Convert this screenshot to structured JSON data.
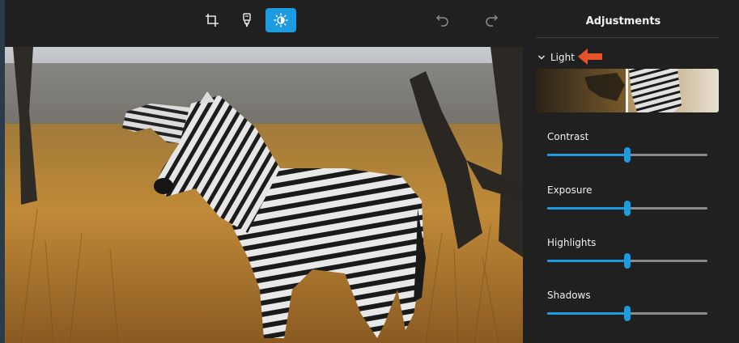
{
  "toolbar": {
    "tools": [
      {
        "name": "crop-tool",
        "icon": "crop-icon",
        "active": false
      },
      {
        "name": "markup-tool",
        "icon": "marker-icon",
        "active": false
      },
      {
        "name": "adjust-tool",
        "icon": "brightness-icon",
        "active": true
      }
    ],
    "undo_icon": "undo-icon",
    "redo_icon": "redo-icon"
  },
  "panel": {
    "title": "Adjustments",
    "section": {
      "label": "Light",
      "expanded": true
    },
    "sliders": [
      {
        "label": "Contrast",
        "level": 0.5
      },
      {
        "label": "Exposure",
        "level": 0.5
      },
      {
        "label": "Highlights",
        "level": 0.5
      },
      {
        "label": "Shadows",
        "level": 0.5
      }
    ]
  },
  "colors": {
    "accent": "#1d9be0",
    "background": "#202020",
    "track": "#8a8a8a",
    "arrow": "#e8522a"
  }
}
